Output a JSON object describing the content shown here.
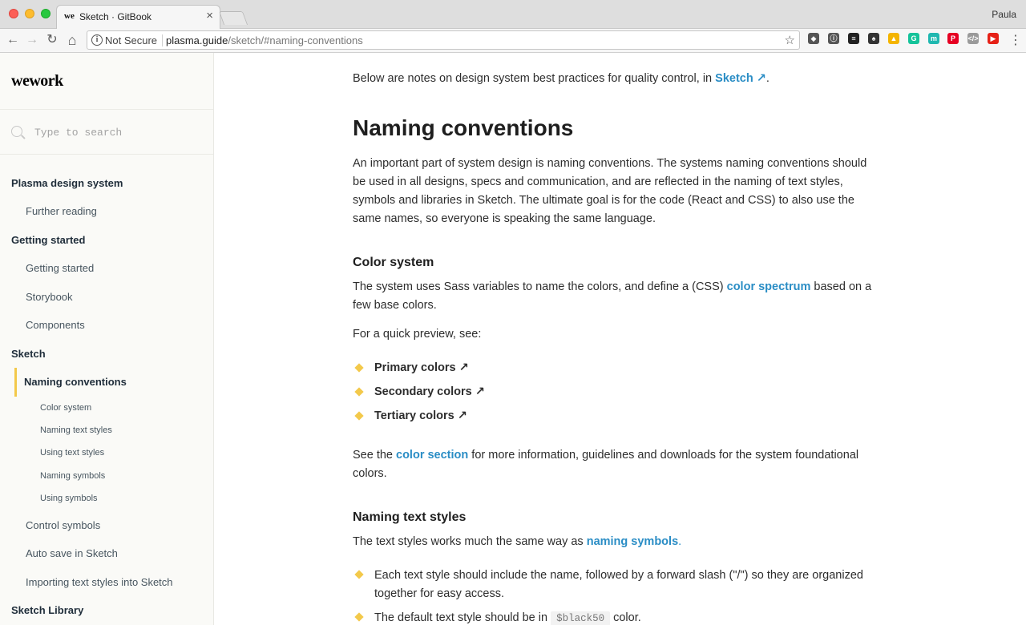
{
  "browser": {
    "tab_title": "Sketch · GitBook",
    "tab_favicon": "we",
    "tab_close": "×",
    "profile_name": "Paula",
    "security_label": "Not Secure",
    "url_host": "plasma.guide",
    "url_path": "/sketch/#naming-conventions",
    "nav_icons": [
      "back-arrow-icon",
      "forward-arrow-icon",
      "reload-icon",
      "home-icon"
    ],
    "nav_glyphs": {
      "back": "←",
      "forward": "→",
      "reload": "↻",
      "home": "⌂"
    },
    "star_glyph": "☆",
    "info_glyph": "i",
    "menu_glyph": "⋮",
    "extensions": [
      {
        "name": "pocket-extension-icon",
        "color": "#555555",
        "glyph": "◆"
      },
      {
        "name": "info-extension-icon",
        "color": "#555555",
        "glyph": "ⓘ"
      },
      {
        "name": "buffer-extension-icon",
        "color": "#222222",
        "glyph": "≡"
      },
      {
        "name": "evernote-extension-icon",
        "color": "#333333",
        "glyph": "♠"
      },
      {
        "name": "drive-extension-icon",
        "color": "#f4b400",
        "glyph": "▲"
      },
      {
        "name": "grammarly-extension-icon",
        "color": "#15c39a",
        "glyph": "G"
      },
      {
        "name": "m-extension-icon",
        "color": "#20b8b0",
        "glyph": "m"
      },
      {
        "name": "pinterest-extension-icon",
        "color": "#e60023",
        "glyph": "P"
      },
      {
        "name": "code-extension-icon",
        "color": "#9a9a9a",
        "glyph": "</>"
      },
      {
        "name": "youtube-extension-icon",
        "color": "#e62117",
        "glyph": "▶"
      }
    ]
  },
  "sidebar": {
    "logo": "wework",
    "search_placeholder": "Type to search",
    "items": [
      {
        "label": "Plasma design system",
        "level": "h"
      },
      {
        "label": "Further reading",
        "level": "l1"
      },
      {
        "label": "Getting started",
        "level": "h"
      },
      {
        "label": "Getting started",
        "level": "l1"
      },
      {
        "label": "Storybook",
        "level": "l1"
      },
      {
        "label": "Components",
        "level": "l1"
      },
      {
        "label": "Sketch",
        "level": "h"
      },
      {
        "label": "Naming conventions",
        "level": "active"
      },
      {
        "label": "Color system",
        "level": "l2"
      },
      {
        "label": "Naming text styles",
        "level": "l2"
      },
      {
        "label": "Using text styles",
        "level": "l2"
      },
      {
        "label": "Naming symbols",
        "level": "l2"
      },
      {
        "label": "Using symbols",
        "level": "l2"
      },
      {
        "label": "Control symbols",
        "level": "l1"
      },
      {
        "label": "Auto save in Sketch",
        "level": "l1"
      },
      {
        "label": "Importing text styles into Sketch",
        "level": "l1"
      },
      {
        "label": "Sketch Library",
        "level": "h"
      }
    ],
    "accent_color": "#f3c94b"
  },
  "content": {
    "intro_prefix": "Below are notes on design system best practices for quality control, in ",
    "intro_link": "Sketch ↗",
    "intro_suffix": ".",
    "heading": "Naming conventions",
    "naming_paragraph": "An important part of system design is naming conventions. The systems naming conventions should be used in all designs, specs and communication, and are reflected in the naming of text styles, symbols and libraries in Sketch. The ultimate goal is for the code (React and CSS) to also use the same names, so everyone is speaking the same language.",
    "color_heading": "Color system",
    "color_p_prefix": "The system uses Sass variables to name the colors, and define a (CSS) ",
    "color_p_link": "color spectrum",
    "color_p_suffix": " based on a few base colors.",
    "preview_text": "For a quick preview, see:",
    "preview_links": [
      "Primary colors ↗",
      "Secondary colors ↗",
      "Tertiary colors ↗"
    ],
    "see_prefix": "See the ",
    "see_link": "color section",
    "see_suffix": " for more information, guidelines and downloads for the system foundational colors.",
    "text_styles_heading": "Naming text styles",
    "text_styles_prefix": "The text styles works much the same way as ",
    "text_styles_link": "naming symbols",
    "text_styles_suffix": ".",
    "bullet1": "Each text style should include the name, followed by a forward slash (\"/\") so they are organized together for easy access.",
    "bullet2_prefix": "The default text style should be in ",
    "bullet2_code": "$black50",
    "bullet2_suffix": " color.",
    "link_color": "#2a8dc5"
  }
}
